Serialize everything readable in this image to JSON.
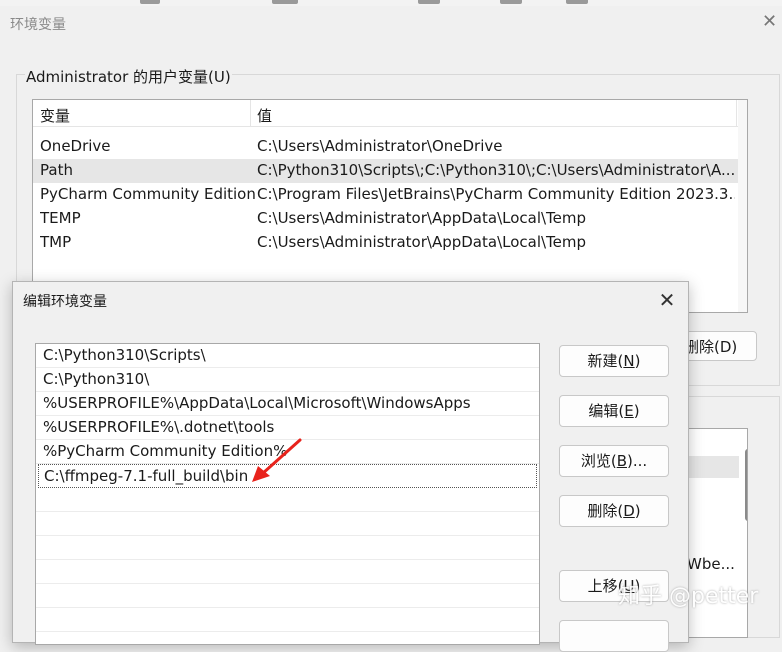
{
  "bg_window": {
    "title": "环境变量",
    "close": "✕",
    "group_label": "Administrator 的用户变量(U)",
    "columns": [
      "变量",
      "值"
    ],
    "rows": [
      {
        "name": "OneDrive",
        "value": "C:\\Users\\Administrator\\OneDrive"
      },
      {
        "name": "Path",
        "value": "C:\\Python310\\Scripts\\;C:\\Python310\\;C:\\Users\\Administrator\\A..."
      },
      {
        "name": "PyCharm Community Edition",
        "value": "C:\\Program Files\\JetBrains\\PyCharm Community Edition 2023.3...."
      },
      {
        "name": "TEMP",
        "value": "C:\\Users\\Administrator\\AppData\\Local\\Temp"
      },
      {
        "name": "TMP",
        "value": "C:\\Users\\Administrator\\AppData\\Local\\Temp"
      }
    ],
    "delete_button": "删除(D)",
    "system_list_partial": "Wbe..."
  },
  "dialog": {
    "title": "编辑环境变量",
    "close": "✕",
    "paths": [
      "C:\\Python310\\Scripts\\",
      "C:\\Python310\\",
      "%USERPROFILE%\\AppData\\Local\\Microsoft\\WindowsApps",
      "%USERPROFILE%\\.dotnet\\tools",
      "%PyCharm Community Edition%",
      "C:\\ffmpeg-7.1-full_build\\bin"
    ],
    "buttons": {
      "new": {
        "label": "新建(",
        "key": "N",
        "tail": ")"
      },
      "edit": {
        "label": "编辑(",
        "key": "E",
        "tail": ")"
      },
      "browse": {
        "label": "浏览(",
        "key": "B",
        "tail": ")..."
      },
      "delete": {
        "label": "删除(",
        "key": "D",
        "tail": ")"
      },
      "move_up": {
        "label": "上移(",
        "key": "U",
        "tail": ")"
      }
    }
  },
  "watermark": "知乎 @petter",
  "colors": {
    "arrow": "#e8231c",
    "selection": "#e6e6e6"
  }
}
